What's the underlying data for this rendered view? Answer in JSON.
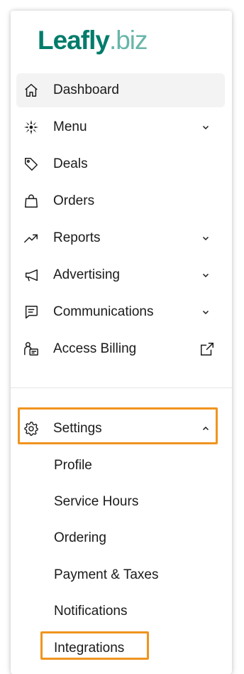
{
  "logo": {
    "brand": "Leafly",
    "tld": ".biz"
  },
  "nav": {
    "items": [
      {
        "label": "Dashboard"
      },
      {
        "label": "Menu"
      },
      {
        "label": "Deals"
      },
      {
        "label": "Orders"
      },
      {
        "label": "Reports"
      },
      {
        "label": "Advertising"
      },
      {
        "label": "Communications"
      },
      {
        "label": "Access Billing"
      }
    ]
  },
  "settings": {
    "label": "Settings",
    "subitems": [
      {
        "label": "Profile"
      },
      {
        "label": "Service Hours"
      },
      {
        "label": "Ordering"
      },
      {
        "label": "Payment & Taxes"
      },
      {
        "label": "Notifications"
      },
      {
        "label": "Integrations"
      }
    ]
  },
  "icons": {
    "dashboard": "home-icon",
    "menu": "cannabis-leaf-icon",
    "deals": "tag-icon",
    "orders": "shopping-bag-icon",
    "reports": "trend-up-icon",
    "advertising": "megaphone-icon",
    "communications": "message-icon",
    "billing": "person-card-icon",
    "settings": "gear-icon",
    "external": "external-link-icon"
  },
  "colors": {
    "brand": "#017c6b",
    "brand_light": "#68b6a9",
    "highlight": "#f0941f",
    "active_bg": "#f3f3f3"
  }
}
